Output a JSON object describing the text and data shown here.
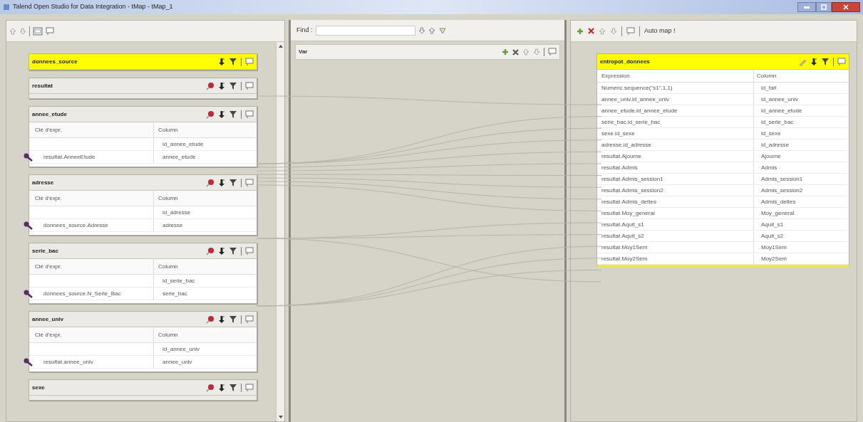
{
  "window": {
    "title": "Talend Open Studio for Data Integration - tMap - tMap_1"
  },
  "inputs": {
    "tables": [
      {
        "name": "donnees_source",
        "selected": true,
        "filter": false
      },
      {
        "name": "resultat",
        "selected": false,
        "filter": true
      },
      {
        "name": "annee_etude",
        "selected": false,
        "filter": true,
        "columns": [
          "Clé d'expr.",
          "Column"
        ],
        "rows": [
          {
            "column": "id_annee_etude",
            "key": false
          },
          {
            "expr": "resultat.AnneeEtude",
            "column": "annee_etude",
            "key": true
          }
        ]
      },
      {
        "name": "adresse",
        "selected": false,
        "filter": true,
        "columns": [
          "Clé d'expr.",
          "Column"
        ],
        "rows": [
          {
            "column": "id_adresse",
            "key": false
          },
          {
            "expr": "donnees_source.Adresse",
            "column": "adresse",
            "key": true
          }
        ]
      },
      {
        "name": "serie_bac",
        "selected": false,
        "filter": true,
        "columns": [
          "Clé d'expr.",
          "Column"
        ],
        "rows": [
          {
            "column": "id_serie_bac",
            "key": false
          },
          {
            "expr": "donnees_source.N_Serie_Bac",
            "column": "serie_bac",
            "key": true
          }
        ]
      },
      {
        "name": "annee_univ",
        "selected": false,
        "filter": true,
        "columns": [
          "Clé d'expr.",
          "Column"
        ],
        "rows": [
          {
            "column": "id_annee_univ",
            "key": false
          },
          {
            "expr": "resultat.annee_univ",
            "column": "annee_univ",
            "key": true
          }
        ]
      },
      {
        "name": "sexe",
        "selected": false,
        "filter": true
      }
    ]
  },
  "vars": {
    "find_label": "Find :",
    "title": "Var"
  },
  "outputs": {
    "auto_map": "Auto map !",
    "table": {
      "name": "entropot_donnees",
      "selected": true,
      "columns": [
        "Expression",
        "Column"
      ],
      "rows": [
        {
          "expr": "Numeric.sequence(\"s1\",1,1)",
          "column": "id_fait"
        },
        {
          "expr": "annee_univ.id_annee_univ",
          "column": "id_annee_univ"
        },
        {
          "expr": "annee_etude.id_annee_etude",
          "column": "id_annee_etude"
        },
        {
          "expr": "serie_bac.id_serie_bac",
          "column": "id_serie_bac"
        },
        {
          "expr": "sexe.id_sexe",
          "column": "id_sexe"
        },
        {
          "expr": "adresse.id_adresse",
          "column": "id_adresse"
        },
        {
          "expr": "resultat.Ajourne",
          "column": "Ajourne"
        },
        {
          "expr": "resultat.Admis",
          "column": "Admis"
        },
        {
          "expr": "resultat.Admis_session1",
          "column": "Admis_session1"
        },
        {
          "expr": "resultat.Admis_session2",
          "column": "Admis_session2"
        },
        {
          "expr": "resultat.Admis_dettes",
          "column": "Admis_dettes"
        },
        {
          "expr": "resultat.Moy_general",
          "column": "Moy_general"
        },
        {
          "expr": "resultat.Aquit_s1",
          "column": "Aquit_s1"
        },
        {
          "expr": "resultat.Aquit_s2",
          "column": "Aquit_s2"
        },
        {
          "expr": "resultat.Moy1Sem",
          "column": "Moy1Sem"
        },
        {
          "expr": "resultat.Moy2Sem",
          "column": "Moy2Sem"
        }
      ]
    }
  }
}
